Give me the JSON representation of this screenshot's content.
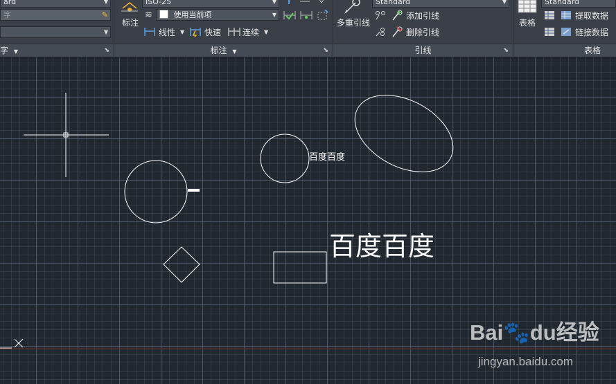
{
  "ribbon": {
    "text_panel": {
      "style_combo": "ard",
      "search_combo": "字",
      "layer_combo": "",
      "title": "字"
    },
    "annotation_panel": {
      "dim_button": "标注",
      "dim_style": "ISO-25",
      "layer_value": "使用当前项",
      "linear": "线性",
      "quick": "快速",
      "continue": "连续",
      "title": "标注"
    },
    "leader_panel": {
      "multileader_button": "多重引线",
      "leader_style": "Standard",
      "add_leader": "添加引线",
      "remove_leader": "删除引线",
      "title": "引线"
    },
    "table_panel": {
      "table_button": "表格",
      "table_style": "Standard",
      "extract_data": "提取数据",
      "link_data": "链接数据",
      "title": "表格"
    }
  },
  "drawing": {
    "small_label": "百度百度",
    "large_label": "百度百度"
  },
  "watermark": {
    "logo": "Bai🐾du经验",
    "url": "jingyan.baidu.com"
  },
  "colors": {
    "canvas_bg": "#212830",
    "ribbon_bg": "#3b4048",
    "cad_line": "#ffffff",
    "x_axis": "#7a2a2a"
  }
}
